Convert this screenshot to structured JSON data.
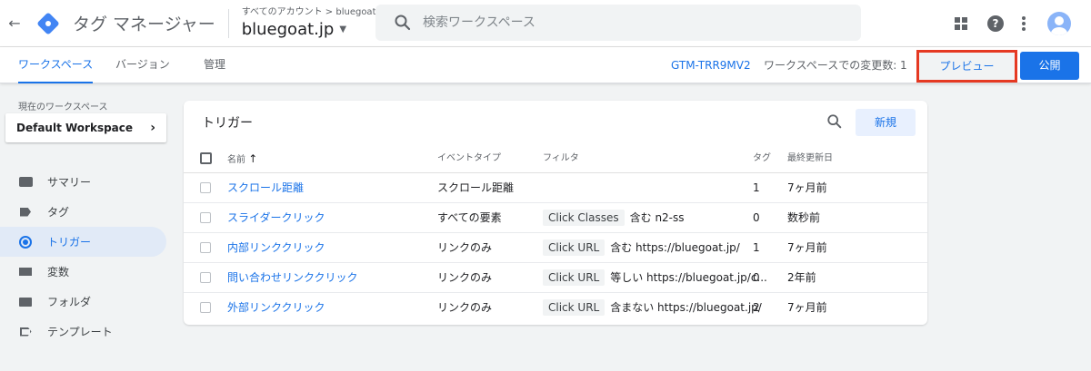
{
  "header": {
    "back_icon": "arrow-back-icon",
    "product_name": "タグ マネージャー",
    "breadcrumb": "すべてのアカウント > bluegoat",
    "container_name": "bluegoat.jp",
    "search_placeholder": "検索ワークスペース"
  },
  "subnav": {
    "tabs": [
      {
        "label": "ワークスペース",
        "active": true
      },
      {
        "label": "バージョン",
        "active": false
      },
      {
        "label": "管理",
        "active": false
      }
    ],
    "container_id": "GTM-TRR9MV2",
    "changes_label": "ワークスペースでの変更数: 1",
    "preview_label": "プレビュー",
    "publish_label": "公開",
    "highlight_color": "#e53922"
  },
  "sidebar": {
    "workspace_label": "現在のワークスペース",
    "workspace_name": "Default Workspace",
    "items": [
      {
        "label": "サマリー",
        "icon": "summary-icon"
      },
      {
        "label": "タグ",
        "icon": "tag-icon"
      },
      {
        "label": "トリガー",
        "icon": "trigger-icon",
        "active": true
      },
      {
        "label": "変数",
        "icon": "variable-icon"
      },
      {
        "label": "フォルダ",
        "icon": "folder-icon"
      },
      {
        "label": "テンプレート",
        "icon": "template-icon"
      }
    ]
  },
  "triggers": {
    "title": "トリガー",
    "new_label": "新規",
    "columns": {
      "name": "名前",
      "event_type": "イベントタイプ",
      "filter": "フィルタ",
      "tags": "タグ",
      "last_updated": "最終更新日"
    },
    "rows": [
      {
        "name": "スクロール距離",
        "event_type": "スクロール距離",
        "filter_chip": "",
        "filter_text": "",
        "tags": "1",
        "updated": "7ヶ月前"
      },
      {
        "name": "スライダークリック",
        "event_type": "すべての要素",
        "filter_chip": "Click Classes",
        "filter_text": "含む n2-ss",
        "tags": "0",
        "updated": "数秒前"
      },
      {
        "name": "内部リンククリック",
        "event_type": "リンクのみ",
        "filter_chip": "Click URL",
        "filter_text": "含む https://bluegoat.jp/",
        "tags": "1",
        "updated": "7ヶ月前"
      },
      {
        "name": "問い合わせリンククリック",
        "event_type": "リンクのみ",
        "filter_chip": "Click URL",
        "filter_text": "等しい https://bluegoat.jp/c...",
        "tags": "0",
        "updated": "2年前"
      },
      {
        "name": "外部リンククリック",
        "event_type": "リンクのみ",
        "filter_chip": "Click URL",
        "filter_text": "含まない https://bluegoat.jp/",
        "tags": "2",
        "updated": "7ヶ月前"
      }
    ]
  }
}
